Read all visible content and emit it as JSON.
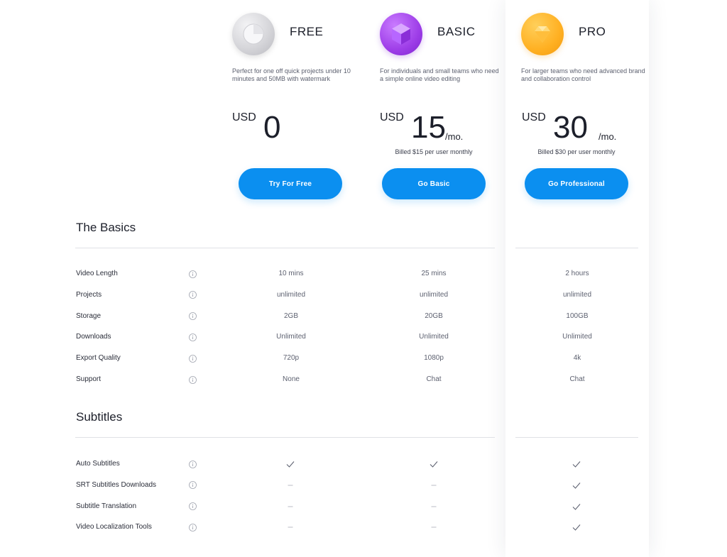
{
  "plans": [
    {
      "name": "FREE",
      "icon": "free-plan-icon",
      "description": "Perfect for one off quick projects under 10 minutes and 50MB with watermark",
      "currency": "USD",
      "amount": "0",
      "period": "",
      "billed": "",
      "button": "Try For Free"
    },
    {
      "name": "BASIC",
      "icon": "basic-plan-icon",
      "description": "For individuals and small teams who need a simple online video editing",
      "currency": "USD",
      "amount": "15",
      "period": "/mo.",
      "billed": "Billed $15 per user monthly",
      "button": "Go Basic"
    },
    {
      "name": "PRO",
      "icon": "pro-plan-icon",
      "description": "For larger teams who need advanced brand and collaboration control",
      "currency": "USD",
      "amount": "30",
      "period": "/mo.",
      "billed": "Billed $30 per user monthly",
      "button": "Go Professional"
    }
  ],
  "sections": [
    {
      "title": "The Basics",
      "rows": [
        {
          "label": "Video Length",
          "values": [
            "10 mins",
            "25 mins",
            "2 hours"
          ]
        },
        {
          "label": "Projects",
          "values": [
            "unlimited",
            "unlimited",
            "unlimited"
          ]
        },
        {
          "label": "Storage",
          "values": [
            "2GB",
            "20GB",
            "100GB"
          ]
        },
        {
          "label": "Downloads",
          "values": [
            "Unlimited",
            "Unlimited",
            "Unlimited"
          ]
        },
        {
          "label": "Export Quality",
          "values": [
            "720p",
            "1080p",
            "4k"
          ]
        },
        {
          "label": "Support",
          "values": [
            "None",
            "Chat",
            "Chat"
          ]
        }
      ]
    },
    {
      "title": "Subtitles",
      "rows": [
        {
          "label": "Auto Subtitles",
          "marks": [
            "check",
            "check",
            "check"
          ]
        },
        {
          "label": "SRT Subtitles Downloads",
          "marks": [
            "dash",
            "dash",
            "check"
          ]
        },
        {
          "label": "Subtitle Translation",
          "marks": [
            "dash",
            "dash",
            "check"
          ]
        },
        {
          "label": "Video Localization Tools",
          "marks": [
            "dash",
            "dash",
            "check"
          ]
        }
      ]
    }
  ],
  "colors": {
    "accent": "#0b8ff0",
    "free": "#d6d6da",
    "basic": "#9e3ee8",
    "pro": "#ffb022"
  }
}
